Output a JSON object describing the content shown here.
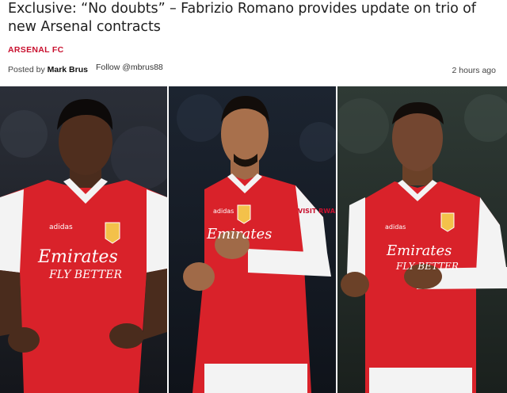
{
  "article": {
    "headline": "Exclusive: “No doubts” – Fabrizio Romano provides update on trio of new Arsenal contracts",
    "category": "ARSENAL FC",
    "posted_by_prefix": "Posted by",
    "author": "Mark Brus",
    "follow": "Follow @mbrus88",
    "time": "2 hours ago"
  },
  "photos": [
    {
      "shirt_sponsor": "Emirates",
      "shirt_slogan": "FLY BETTER",
      "kit_brand": "adidas"
    },
    {
      "shirt_sponsor": "Emirates",
      "sleeve_sponsor": "VISIT RWANDA",
      "kit_brand": "adidas"
    },
    {
      "shirt_sponsor": "Emirates",
      "shirt_slogan": "FLY BETTER",
      "kit_brand": "adidas"
    }
  ],
  "colors": {
    "accent": "#c8102e",
    "kit_red": "#d9222a",
    "kit_white": "#f3f3f3",
    "stadium_dark": "#1a1d24"
  }
}
